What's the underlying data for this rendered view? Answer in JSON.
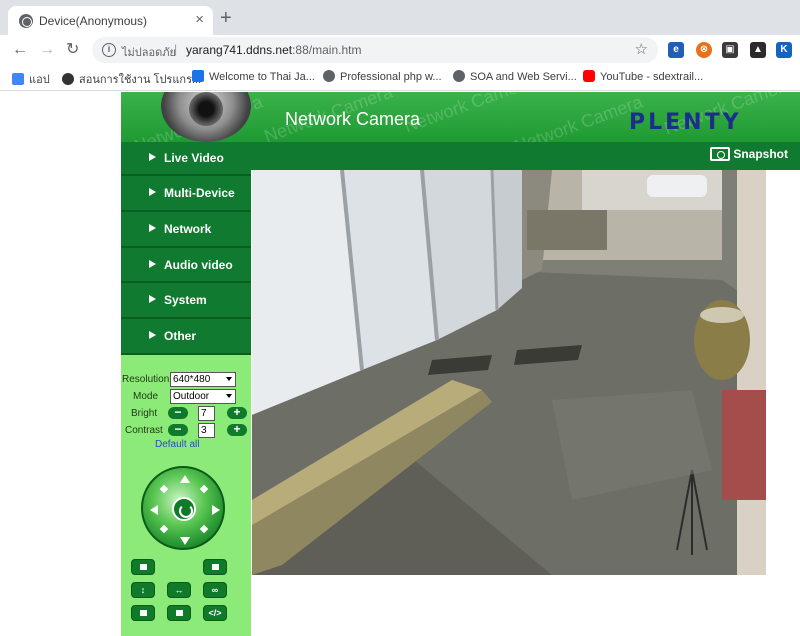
{
  "browser": {
    "tab_title": "Device(Anonymous)",
    "close_glyph": "×",
    "new_tab_glyph": "+",
    "security_label": "ไม่ปลอดภัย",
    "url_host": "yarang741.ddns.net",
    "url_path": ":88/main.htm",
    "bookmarks": [
      {
        "label": "แอป",
        "icon": "apps-grid-icon",
        "color": "#4285f4"
      },
      {
        "label": "สอนการใช้งาน โปรแกร...",
        "icon": "avatar-icon",
        "color": "#333333"
      },
      {
        "label": "Welcome to Thai Ja...",
        "icon": "hm-logo-icon",
        "color": "#1a73e8"
      },
      {
        "label": "Professional php w...",
        "icon": "globe-icon",
        "color": "#5f6368"
      },
      {
        "label": "SOA and Web Servi...",
        "icon": "globe-icon",
        "color": "#5f6368"
      },
      {
        "label": "YouTube - sdextrail...",
        "icon": "youtube-icon",
        "color": "#ff0000"
      }
    ],
    "extensions": [
      {
        "icon": "edge-icon",
        "glyph": "e",
        "color": "#1f5fb8"
      },
      {
        "icon": "orange-icon",
        "glyph": "⊗",
        "color": "#e8711a"
      },
      {
        "icon": "dark-ext-icon",
        "glyph": "▣",
        "color": "#3a3a3a"
      },
      {
        "icon": "cat-icon",
        "glyph": "▲",
        "color": "#2b2b2b"
      },
      {
        "icon": "k-icon",
        "glyph": "K",
        "color": "#1565c0"
      }
    ]
  },
  "camera": {
    "banner_title": "Network Camera",
    "brand": "PLENTY",
    "watermark": "Network Camera",
    "snapshot_label": "Snapshot",
    "menu": [
      "Live Video",
      "Multi-Device",
      "Network",
      "Audio video",
      "System",
      "Other"
    ],
    "controls": {
      "resolution_label": "Resolution",
      "resolution_value": "640*480",
      "mode_label": "Mode",
      "mode_value": "Outdoor",
      "bright_label": "Bright",
      "bright_value": "7",
      "contrast_label": "Contrast",
      "contrast_value": "3",
      "minus_glyph": "−",
      "plus_glyph": "+",
      "default_all_label": "Default all"
    },
    "ptz_buttons": {
      "vflip_glyph": "↕",
      "hflip_glyph": "↔",
      "cruise_glyph": "∞",
      "code_glyph": "</>"
    }
  },
  "colors": {
    "banner_green": "#2aa63c",
    "menu_green": "#107a30",
    "sidebar_green": "#8cea78",
    "brand_blue": "#1b2f8a"
  }
}
